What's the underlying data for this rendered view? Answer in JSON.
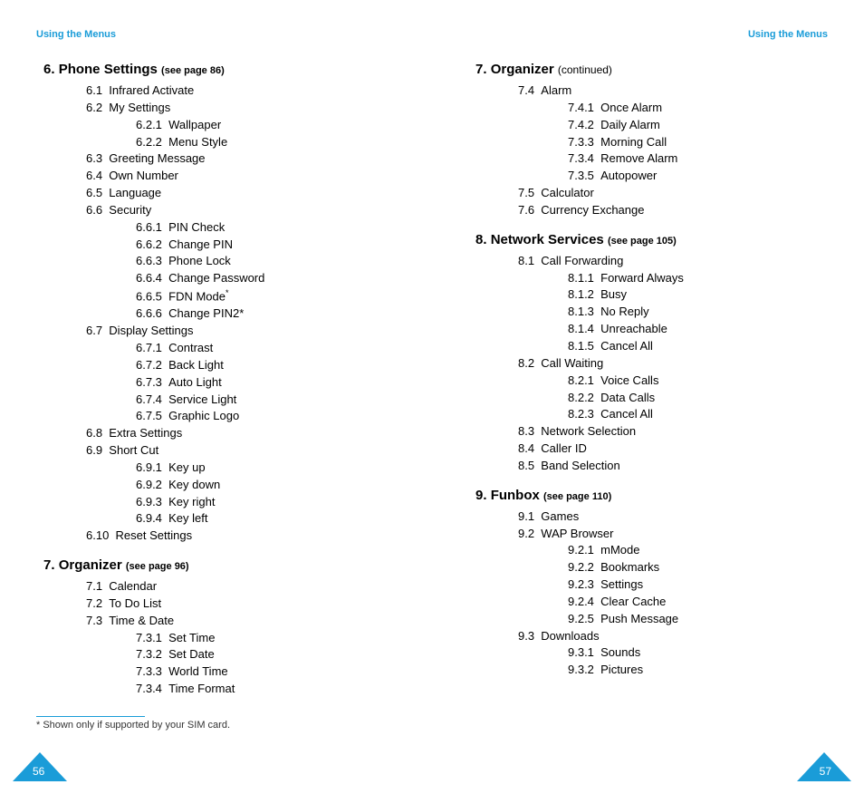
{
  "header_left": "Using the Menus",
  "header_right": "Using the Menus",
  "page_num_left": "56",
  "page_num_right": "57",
  "footnote": "* Shown only if supported by your SIM card.",
  "s6": {
    "num": "6.",
    "title": "Phone Settings",
    "ref": "(see page 86)",
    "items": [
      {
        "n": "6.1",
        "t": "Infrared Activate"
      },
      {
        "n": "6.2",
        "t": "My Settings"
      },
      {
        "n": "6.2.1",
        "t": "Wallpaper",
        "sub": true
      },
      {
        "n": "6.2.2",
        "t": "Menu Style",
        "sub": true
      },
      {
        "n": "6.3",
        "t": "Greeting Message"
      },
      {
        "n": "6.4",
        "t": "Own Number"
      },
      {
        "n": "6.5",
        "t": "Language"
      },
      {
        "n": "6.6",
        "t": "Security"
      },
      {
        "n": "6.6.1",
        "t": "PIN Check",
        "sub": true
      },
      {
        "n": "6.6.2",
        "t": "Change PIN",
        "sub": true
      },
      {
        "n": "6.6.3",
        "t": "Phone Lock",
        "sub": true
      },
      {
        "n": "6.6.4",
        "t": "Change Password",
        "sub": true
      },
      {
        "n": "6.6.5",
        "t": "FDN Mode",
        "sub": true,
        "sup": "*"
      },
      {
        "n": "6.6.6",
        "t": "Change PIN2*",
        "sub": true
      },
      {
        "n": "6.7",
        "t": "Display Settings"
      },
      {
        "n": "6.7.1",
        "t": "Contrast",
        "sub": true
      },
      {
        "n": "6.7.2",
        "t": "Back Light",
        "sub": true
      },
      {
        "n": "6.7.3",
        "t": "Auto Light",
        "sub": true
      },
      {
        "n": "6.7.4",
        "t": "Service Light",
        "sub": true
      },
      {
        "n": "6.7.5",
        "t": "Graphic Logo",
        "sub": true
      },
      {
        "n": "6.8",
        "t": "Extra Settings"
      },
      {
        "n": "6.9",
        "t": "Short Cut"
      },
      {
        "n": "6.9.1",
        "t": "Key up",
        "sub": true
      },
      {
        "n": "6.9.2",
        "t": "Key down",
        "sub": true
      },
      {
        "n": "6.9.3",
        "t": "Key right",
        "sub": true
      },
      {
        "n": "6.9.4",
        "t": "Key left",
        "sub": true
      },
      {
        "n": "6.10",
        "t": "Reset Settings"
      }
    ]
  },
  "s7a": {
    "num": "7.",
    "title": "Organizer",
    "ref": "(see page 96)",
    "items": [
      {
        "n": "7.1",
        "t": "Calendar"
      },
      {
        "n": "7.2",
        "t": "To Do List"
      },
      {
        "n": "7.3",
        "t": "Time & Date"
      },
      {
        "n": "7.3.1",
        "t": "Set Time",
        "sub": true
      },
      {
        "n": "7.3.2",
        "t": "Set Date",
        "sub": true
      },
      {
        "n": "7.3.3",
        "t": "World Time",
        "sub": true
      },
      {
        "n": "7.3.4",
        "t": "Time Format",
        "sub": true
      }
    ]
  },
  "s7b": {
    "num": "7.",
    "title": "Organizer",
    "cont": "(continued)",
    "items": [
      {
        "n": "7.4",
        "t": "Alarm"
      },
      {
        "n": "7.4.1",
        "t": "Once Alarm",
        "sub": true
      },
      {
        "n": "7.4.2",
        "t": "Daily Alarm",
        "sub": true
      },
      {
        "n": "7.3.3",
        "t": "Morning Call",
        "sub": true
      },
      {
        "n": "7.3.4",
        "t": "Remove Alarm",
        "sub": true
      },
      {
        "n": "7.3.5",
        "t": "Autopower",
        "sub": true
      },
      {
        "n": "7.5",
        "t": "Calculator"
      },
      {
        "n": "7.6",
        "t": "Currency Exchange"
      }
    ]
  },
  "s8": {
    "num": "8.",
    "title": "Network Services",
    "ref": "(see page 105)",
    "items": [
      {
        "n": "8.1",
        "t": "Call Forwarding"
      },
      {
        "n": "8.1.1",
        "t": "Forward Always",
        "sub": true
      },
      {
        "n": "8.1.2",
        "t": "Busy",
        "sub": true
      },
      {
        "n": "8.1.3",
        "t": "No Reply",
        "sub": true
      },
      {
        "n": "8.1.4",
        "t": "Unreachable",
        "sub": true
      },
      {
        "n": "8.1.5",
        "t": "Cancel All",
        "sub": true
      },
      {
        "n": "8.2",
        "t": "Call Waiting"
      },
      {
        "n": "8.2.1",
        "t": "Voice Calls",
        "sub": true
      },
      {
        "n": "8.2.2",
        "t": "Data Calls",
        "sub": true
      },
      {
        "n": "8.2.3",
        "t": "Cancel All",
        "sub": true
      },
      {
        "n": "8.3",
        "t": "Network Selection"
      },
      {
        "n": "8.4",
        "t": "Caller ID"
      },
      {
        "n": "8.5",
        "t": "Band Selection"
      }
    ]
  },
  "s9": {
    "num": "9.",
    "title": "Funbox",
    "ref": "(see page 110)",
    "items": [
      {
        "n": "9.1",
        "t": "Games"
      },
      {
        "n": "9.2",
        "t": "WAP Browser"
      },
      {
        "n": "9.2.1",
        "t": "mMode",
        "sub": true
      },
      {
        "n": "9.2.2",
        "t": "Bookmarks",
        "sub": true
      },
      {
        "n": "9.2.3",
        "t": "Settings",
        "sub": true
      },
      {
        "n": "9.2.4",
        "t": "Clear Cache",
        "sub": true
      },
      {
        "n": "9.2.5",
        "t": "Push Message",
        "sub": true
      },
      {
        "n": "9.3",
        "t": "Downloads"
      },
      {
        "n": "9.3.1",
        "t": "Sounds",
        "sub": true
      },
      {
        "n": "9.3.2",
        "t": "Pictures",
        "sub": true
      }
    ]
  }
}
